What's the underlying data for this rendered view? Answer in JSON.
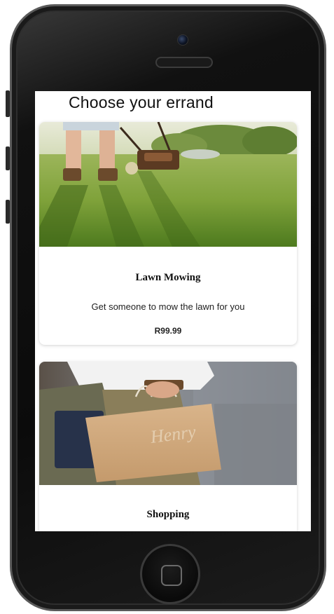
{
  "screen": {
    "title": "Choose your errand"
  },
  "errands": [
    {
      "title": "Lawn Mowing",
      "description": "Get someone to mow the lawn for you",
      "price": "R99.99",
      "image": "lawn-mowing-photo"
    },
    {
      "title": "Shopping",
      "image": "shopping-bag-photo"
    }
  ],
  "icons": {
    "home": "home-button-icon",
    "camera": "front-camera-icon",
    "speaker": "speaker-grille-icon"
  },
  "colors": {
    "phone_body": "#111111",
    "screen_bg": "#ffffff",
    "text": "#111111"
  }
}
